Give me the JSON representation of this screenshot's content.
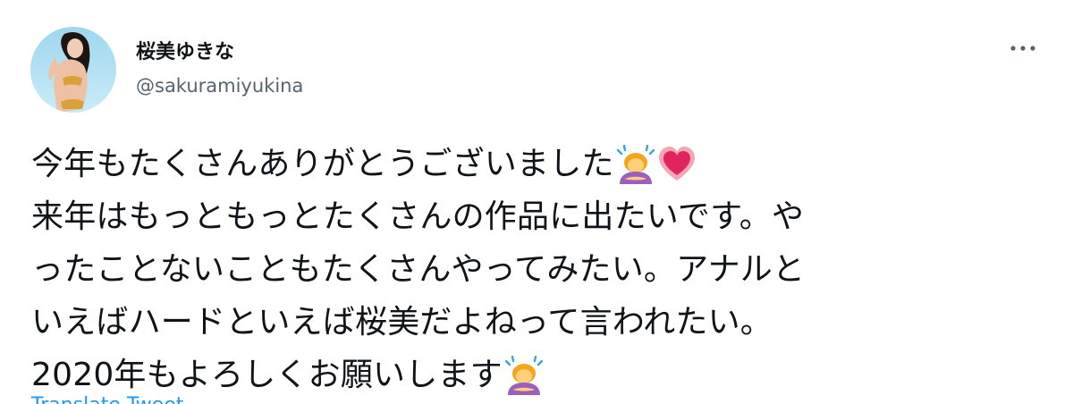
{
  "author": {
    "display_name": "桜美ゆきな",
    "handle": "@sakuramiyukina"
  },
  "tweet": {
    "lines": [
      "今年もたくさんありがとうございました",
      "来年はもっともっとたくさんの作品に出たいです。や",
      "ったことないこともたくさんやってみたい。アナルと",
      "いえばハードといえば桜美だよねって言われたい。",
      "2020年もよろしくお願いします"
    ],
    "line1_emojis": [
      "person-bowing-emoji",
      "heart-emoji"
    ],
    "line5_emojis": [
      "person-bowing-emoji"
    ]
  },
  "translate_link": "Translate Tweet",
  "icons": {
    "more": "more-options-icon"
  },
  "colors": {
    "text": "#0f1419",
    "secondary": "#536471",
    "link": "#1d9bf0"
  }
}
